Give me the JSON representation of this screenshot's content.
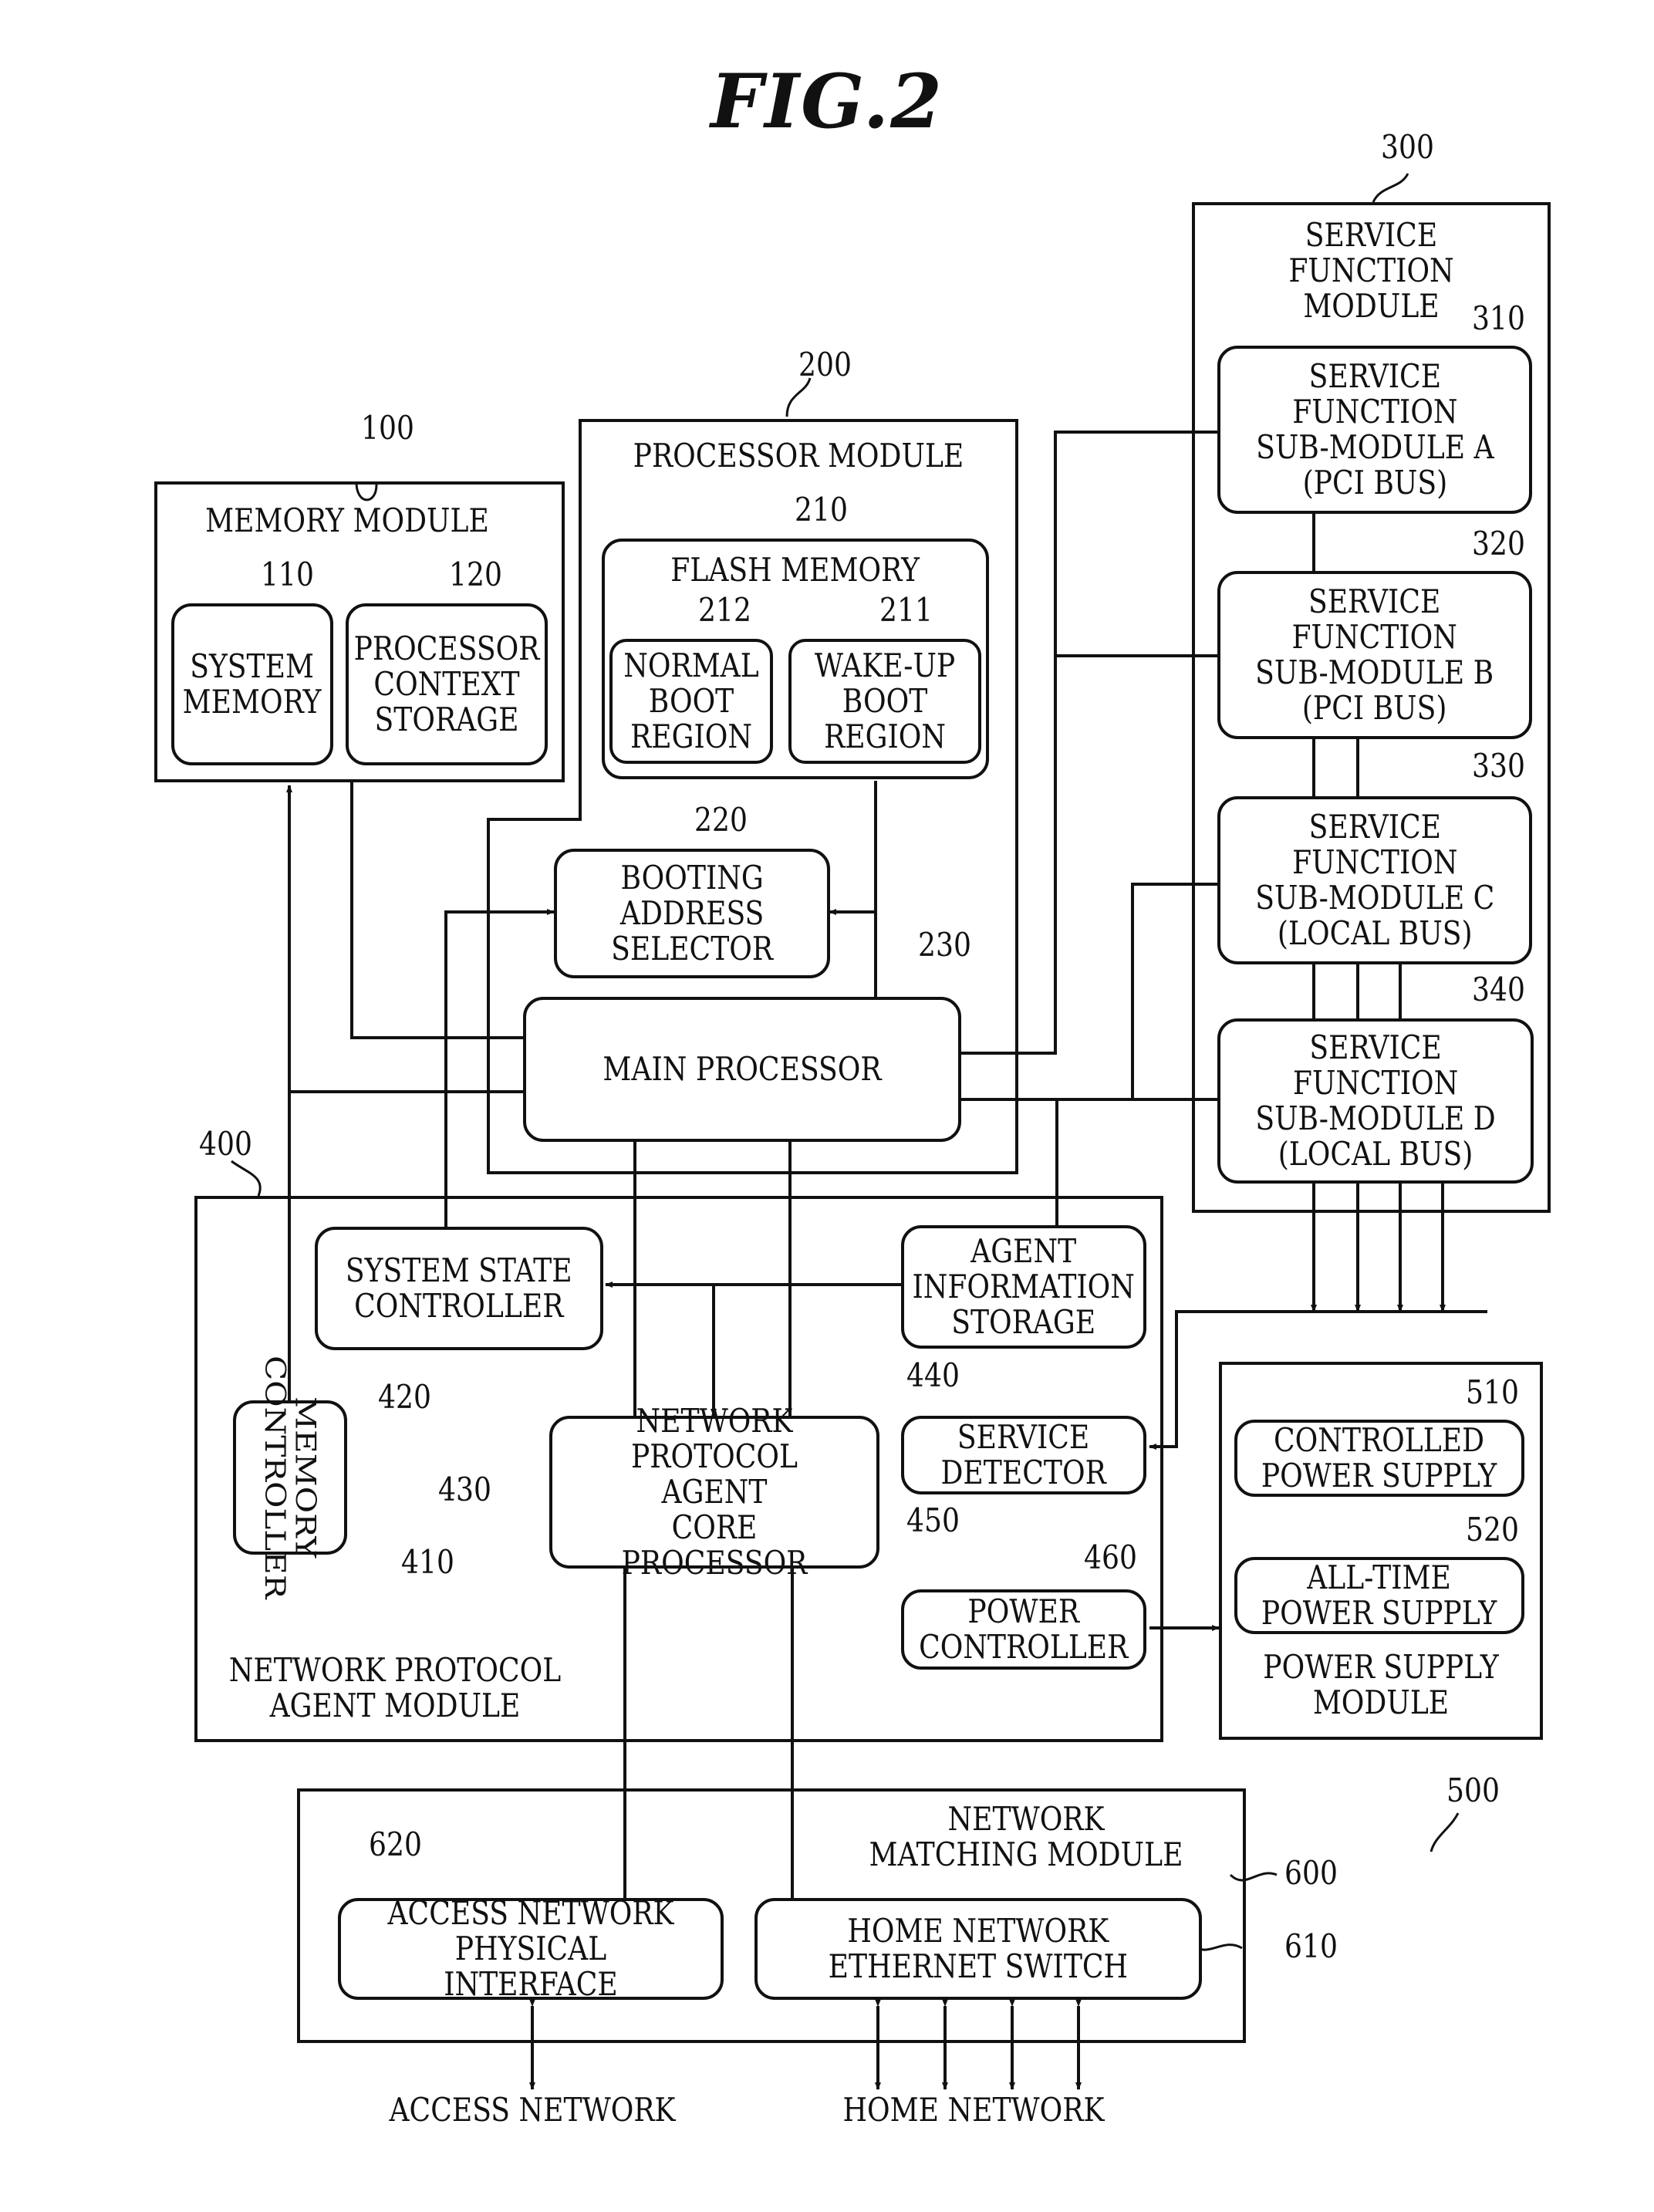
{
  "figure_title": "FIG.2",
  "modules": {
    "memory": {
      "ref": "100",
      "label": "MEMORY MODULE",
      "system_memory": {
        "ref": "110",
        "label": "SYSTEM\nMEMORY"
      },
      "context_storage": {
        "ref": "120",
        "label": "PROCESSOR\nCONTEXT\nSTORAGE"
      }
    },
    "processor": {
      "ref": "200",
      "label": "PROCESSOR MODULE",
      "flash": {
        "ref": "210",
        "label": "FLASH MEMORY"
      },
      "normal_boot": {
        "ref": "212",
        "label": "NORMAL\nBOOT\nREGION"
      },
      "wakeup_boot": {
        "ref": "211",
        "label": "WAKE-UP\nBOOT\nREGION"
      },
      "booting_selector": {
        "ref": "220",
        "label": "BOOTING\nADDRESS\nSELECTOR"
      },
      "main_processor": {
        "ref": "230",
        "label": "MAIN PROCESSOR"
      }
    },
    "service": {
      "ref": "300",
      "label": "SERVICE\nFUNCTION MODULE",
      "sub_a": {
        "ref": "310",
        "label": "SERVICE\nFUNCTION\nSUB-MODULE A\n(PCI BUS)"
      },
      "sub_b": {
        "ref": "320",
        "label": "SERVICE\nFUNCTION\nSUB-MODULE B\n(PCI BUS)"
      },
      "sub_c": {
        "ref": "330",
        "label": "SERVICE\nFUNCTION\nSUB-MODULE C\n(LOCAL BUS)"
      },
      "sub_d": {
        "ref": "340",
        "label": "SERVICE\nFUNCTION\nSUB-MODULE D\n(LOCAL BUS)"
      }
    },
    "agent": {
      "ref": "400",
      "label": "NETWORK PROTOCOL\nAGENT MODULE",
      "memory_controller": {
        "ref": "410",
        "label": "MEMORY\nCONTROLLER"
      },
      "system_state": {
        "ref": "420",
        "label": "SYSTEM STATE\nCONTROLLER"
      },
      "core_processor": {
        "ref": "430",
        "label": "NETWORK\nPROTOCOL  AGENT\nCORE PROCESSOR"
      },
      "agent_info": {
        "ref": "440",
        "label": "AGENT\nINFORMATION\nSTORAGE"
      },
      "service_detector": {
        "ref": "450",
        "label": "SERVICE\nDETECTOR"
      },
      "power_controller": {
        "ref": "460",
        "label": "POWER\nCONTROLLER"
      }
    },
    "power": {
      "ref": "500",
      "label": "POWER SUPPLY\nMODULE",
      "controlled": {
        "ref": "510",
        "label": "CONTROLLED\nPOWER SUPPLY"
      },
      "alltime": {
        "ref": "520",
        "label": "ALL-TIME\nPOWER SUPPLY"
      }
    },
    "network": {
      "ref": "600",
      "label": "NETWORK\nMATCHING MODULE",
      "ethernet_switch": {
        "ref": "610",
        "label": "HOME NETWORK\nETHERNET SWITCH"
      },
      "access_phy": {
        "ref": "620",
        "label": "ACCESS NETWORK\nPHYSICAL INTERFACE"
      }
    }
  },
  "external": {
    "access_network": "ACCESS NETWORK",
    "home_network": "HOME NETWORK"
  }
}
